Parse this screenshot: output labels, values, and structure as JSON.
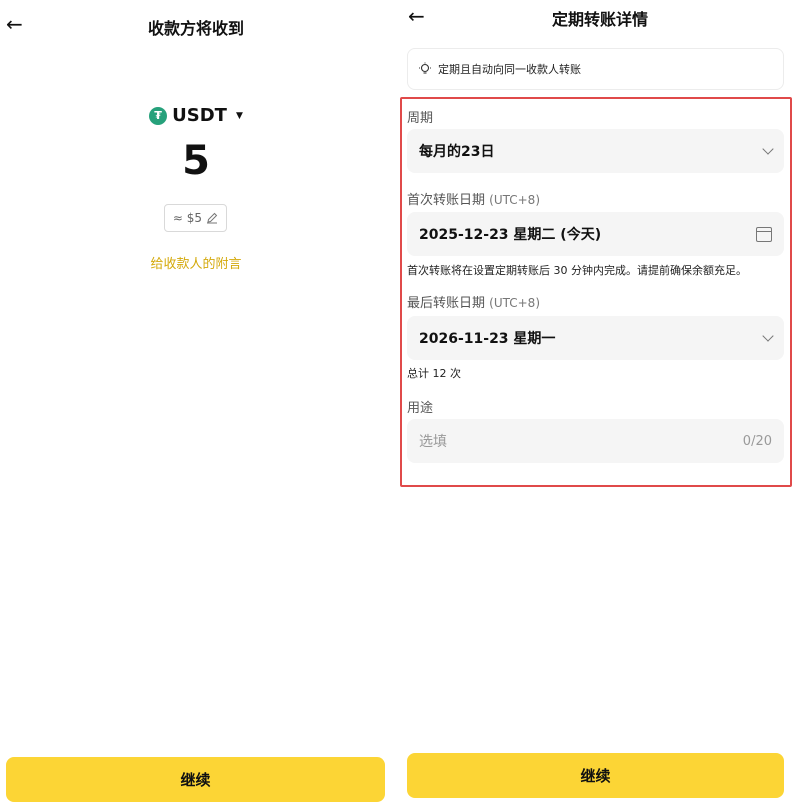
{
  "left": {
    "back_icon": "←",
    "title": "收款方将收到",
    "token": {
      "icon": "tether-icon",
      "icon_glyph": "₮",
      "name": "USDT"
    },
    "amount": "5",
    "fiat": "≈ $5",
    "note_link": "给收款人的附言",
    "continue": "继续"
  },
  "right": {
    "back_icon": "←",
    "title": "定期转账详情",
    "tip": "定期且自动向同一收款人转账",
    "period": {
      "label": "周期",
      "value": "每月的23日"
    },
    "first_date": {
      "label": "首次转账日期",
      "tz": "(UTC+8)",
      "value": "2025-12-23 星期二 (今天)",
      "hint": "首次转账将在设置定期转账后 30 分钟内完成。请提前确保余额充足。"
    },
    "last_date": {
      "label": "最后转账日期",
      "tz": "(UTC+8)",
      "value": "2026-11-23 星期一",
      "hint": "总计 12 次"
    },
    "purpose": {
      "label": "用途",
      "placeholder": "选填",
      "counter": "0/20"
    },
    "continue": "继续"
  },
  "colors": {
    "accent": "#fcd535",
    "link": "#d4a90b",
    "highlight": "#e04a4a",
    "tether": "#26a17b"
  }
}
